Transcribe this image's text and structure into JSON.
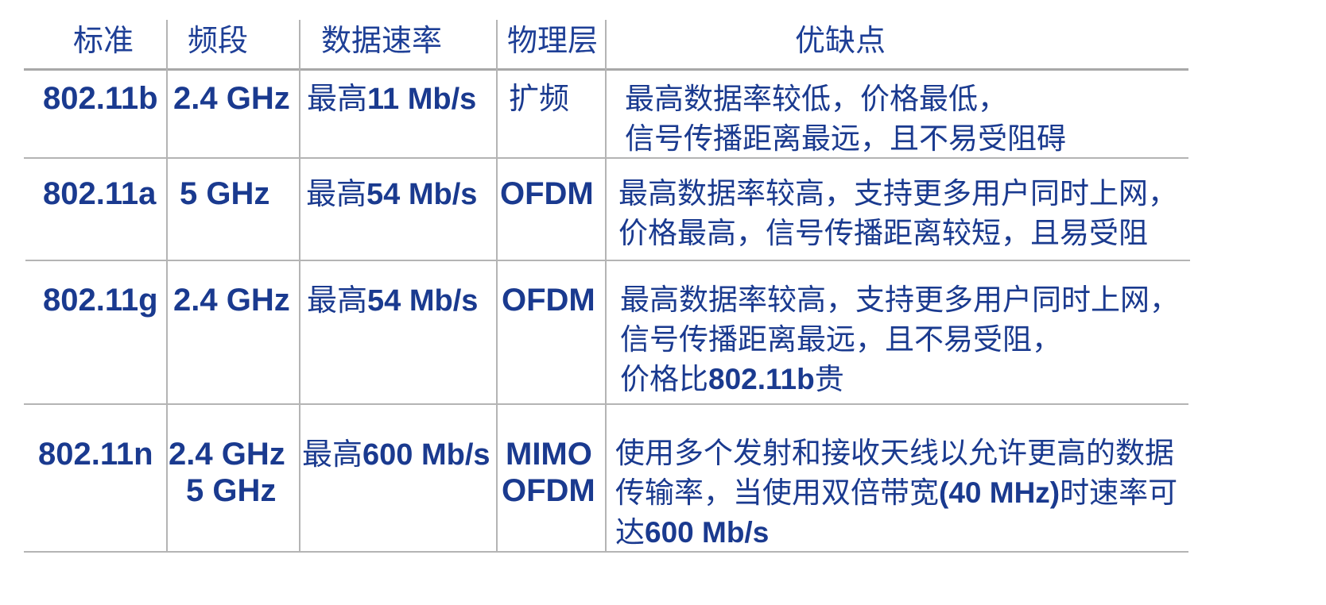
{
  "header": {
    "standard": "标准",
    "band": "频段",
    "rate": "数据速率",
    "phy": "物理层",
    "pros_cons": "优缺点"
  },
  "rows": [
    {
      "standard": "802.11b",
      "band": [
        "2.4 GHz"
      ],
      "rate_prefix": "最高",
      "rate_value": "11 Mb/s",
      "phy": [
        "扩频"
      ],
      "desc": [
        [
          {
            "t": "最高数据率较低，价格最低，"
          }
        ],
        [
          {
            "t": "信号传播距离最远，且不易受阻碍"
          }
        ]
      ]
    },
    {
      "standard": "802.11a",
      "band": [
        "5 GHz"
      ],
      "rate_prefix": "最高",
      "rate_value": "54 Mb/s",
      "phy": [
        "OFDM"
      ],
      "desc": [
        [
          {
            "t": "最高数据率较高，支持更多用户同时上网，"
          }
        ],
        [
          {
            "t": "价格最高，信号传播距离较短，且易受阻"
          }
        ]
      ]
    },
    {
      "standard": "802.11g",
      "band": [
        "2.4 GHz"
      ],
      "rate_prefix": "最高",
      "rate_value": "54 Mb/s",
      "phy": [
        "OFDM"
      ],
      "desc": [
        [
          {
            "t": "最高数据率较高，支持更多用户同时上网，"
          }
        ],
        [
          {
            "t": "信号传播距离最远，且不易受阻，"
          }
        ],
        [
          {
            "t": "价格比"
          },
          {
            "t": "802.11b",
            "b": true
          },
          {
            "t": "贵"
          }
        ]
      ]
    },
    {
      "standard": "802.11n",
      "band": [
        "2.4 GHz",
        "5 GHz"
      ],
      "rate_prefix": "最高",
      "rate_value": "600 Mb/s",
      "phy": [
        "MIMO",
        "OFDM"
      ],
      "desc": [
        [
          {
            "t": "使用多个发射和接收天线以允许更高的数据"
          }
        ],
        [
          {
            "t": "传输率，当使用双倍带宽"
          },
          {
            "t": "(40 MHz)",
            "b": true
          },
          {
            "t": "时速率可"
          }
        ],
        [
          {
            "t": "达"
          },
          {
            "t": "600 Mb/s",
            "b": true
          }
        ]
      ]
    }
  ]
}
